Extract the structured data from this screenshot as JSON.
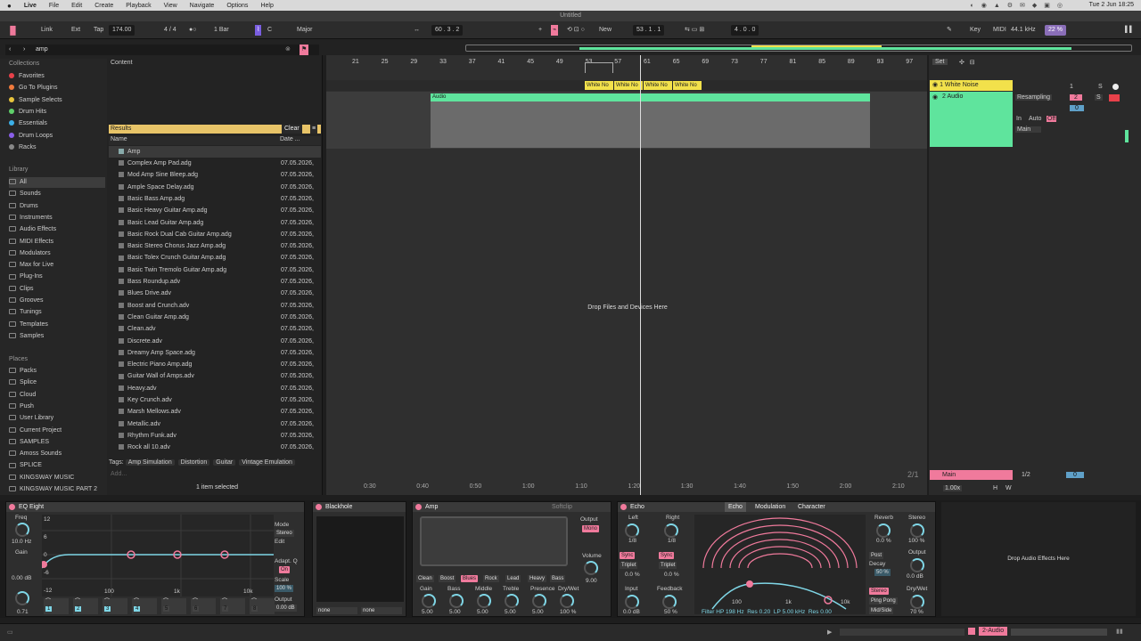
{
  "menubar": {
    "apple": "",
    "app": "Live",
    "items": [
      "File",
      "Edit",
      "Create",
      "Playback",
      "View",
      "Navigate",
      "Options",
      "Help"
    ],
    "clock": "Tue 2 Jun 18:25"
  },
  "window": {
    "title": "Untitled"
  },
  "control": {
    "link": "Link",
    "ext": "Ext",
    "tap": "Tap",
    "tempo": "174.00",
    "sig": "4 / 4",
    "metro": "1 Bar",
    "key": "C",
    "scale": "Major",
    "pos1": "60 .  3 .  2",
    "new": "New",
    "pos2": "53 .  1 .  1",
    "len": "4 .  0 .  0",
    "keymap": "Key",
    "midi": "MIDI",
    "rate": "44.1 kHz",
    "cpu": "22 %"
  },
  "browser": {
    "search": "amp",
    "collections_title": "Collections",
    "collections": [
      {
        "label": "Favorites",
        "color": "#e8414a"
      },
      {
        "label": "Go To Plugins",
        "color": "#f07a3c"
      },
      {
        "label": "Sample Selects",
        "color": "#e8c43c"
      },
      {
        "label": "Drum Hits",
        "color": "#5fd06a"
      },
      {
        "label": "Essentials",
        "color": "#3cb0e8"
      },
      {
        "label": "Drum Loops",
        "color": "#8a5fe8"
      },
      {
        "label": "Racks",
        "color": "#888888"
      }
    ],
    "library_title": "Library",
    "library": [
      "All",
      "Sounds",
      "Drums",
      "Instruments",
      "Audio Effects",
      "MIDI Effects",
      "Modulators",
      "Max for Live",
      "Plug-Ins",
      "Clips",
      "Grooves",
      "Tunings",
      "Templates",
      "Samples"
    ],
    "places_title": "Places",
    "places": [
      "Packs",
      "Splice",
      "Cloud",
      "Push",
      "User Library",
      "Current Project",
      "SAMPLES",
      "Amoss Sounds",
      "SPLICE",
      "KINGSWAY MUSIC",
      "KINGSWAY MUSIC PART 2"
    ],
    "content": "Content",
    "results": "Results",
    "clear": "Clear",
    "col_name": "Name",
    "col_date": "Date ...",
    "folder_row": "Amp",
    "files": [
      {
        "name": "Complex Amp Pad.adg",
        "date": "07.05.2026,"
      },
      {
        "name": "Mod Amp Sine Bleep.adg",
        "date": "07.05.2026,"
      },
      {
        "name": "Ample Space Delay.adg",
        "date": "07.05.2026,"
      },
      {
        "name": "Basic Bass Amp.adg",
        "date": "07.05.2026,"
      },
      {
        "name": "Basic Heavy Guitar Amp.adg",
        "date": "07.05.2026,"
      },
      {
        "name": "Basic Lead Guitar Amp.adg",
        "date": "07.05.2026,"
      },
      {
        "name": "Basic Rock Dual Cab Guitar Amp.adg",
        "date": "07.05.2026,"
      },
      {
        "name": "Basic Stereo Chorus Jazz Amp.adg",
        "date": "07.05.2026,"
      },
      {
        "name": "Basic Tolex Crunch Guitar Amp.adg",
        "date": "07.05.2026,"
      },
      {
        "name": "Basic Twin Tremolo Guitar Amp.adg",
        "date": "07.05.2026,"
      },
      {
        "name": "Bass Roundup.adv",
        "date": "07.05.2026,"
      },
      {
        "name": "Blues Drive.adv",
        "date": "07.05.2026,"
      },
      {
        "name": "Boost and Crunch.adv",
        "date": "07.05.2026,"
      },
      {
        "name": "Clean Guitar Amp.adg",
        "date": "07.05.2026,"
      },
      {
        "name": "Clean.adv",
        "date": "07.05.2026,"
      },
      {
        "name": "Discrete.adv",
        "date": "07.05.2026,"
      },
      {
        "name": "Dreamy Amp Space.adg",
        "date": "07.05.2026,"
      },
      {
        "name": "Electric Piano Amp.adg",
        "date": "07.05.2026,"
      },
      {
        "name": "Guitar Wall of Amps.adv",
        "date": "07.05.2026,"
      },
      {
        "name": "Heavy.adv",
        "date": "07.05.2026,"
      },
      {
        "name": "Key Crunch.adv",
        "date": "07.05.2026,"
      },
      {
        "name": "Marsh Mellows.adv",
        "date": "07.05.2026,"
      },
      {
        "name": "Metallic.adv",
        "date": "07.05.2026,"
      },
      {
        "name": "Rhythm Funk.adv",
        "date": "07.05.2026,"
      },
      {
        "name": "Rock all 10.adv",
        "date": "07.05.2026,"
      }
    ],
    "tags_label": "Tags:",
    "tags": [
      "Amp Simulation",
      "Distortion",
      "Guitar",
      "Vintage Emulation"
    ],
    "add": "Add...",
    "status": "1 item selected"
  },
  "arrangement": {
    "bars": [
      "21",
      "25",
      "29",
      "33",
      "37",
      "41",
      "45",
      "49",
      "53",
      "57",
      "61",
      "65",
      "69",
      "73",
      "77",
      "81",
      "85",
      "89",
      "93",
      "97"
    ],
    "locators": [
      "White No",
      "White No",
      "White No",
      "White No"
    ],
    "clip_name": "Audio",
    "drop": "Drop Files and Devices Here",
    "times": [
      "0:30",
      "0:40",
      "0:50",
      "1:00",
      "1:10",
      "1:20",
      "1:30",
      "1:40",
      "1:50",
      "2:00",
      "2:10"
    ],
    "zoom": "2/1"
  },
  "mixer": {
    "set": "Set",
    "track1": "1 White Noise",
    "track2": "2 Audio",
    "resampling": "Resampling",
    "in": "In",
    "auto": "Auto",
    "off": "Off",
    "main_route": "Main",
    "main": "Main",
    "main_val": "1/2",
    "num1": "1",
    "num2": "2",
    "s": "S",
    "vol": "0",
    "speed": "1.00x",
    "h": "H",
    "w": "W"
  },
  "devices": {
    "eq": {
      "title": "EQ Eight",
      "freq": "Freq",
      "freq_val": "10.0 Hz",
      "gain": "Gain",
      "gain_val": "0.00 dB",
      "q_val": "0.71",
      "mode": "Mode",
      "stereo": "Stereo",
      "edit": "Edit",
      "adapt": "Adapt. Q",
      "on": "On",
      "scale": "Scale",
      "scale_val": "100 %",
      "output": "Output",
      "output_val": "0.00 dB",
      "db": [
        "12",
        "6",
        "0",
        "-6",
        "-12"
      ],
      "freqs": [
        "100",
        "1k",
        "10k"
      ],
      "bands": [
        "1",
        "2",
        "3",
        "4",
        "5",
        "6",
        "7",
        "8"
      ]
    },
    "blackhole": {
      "title": "Blackhole",
      "none1": "none",
      "none2": "none"
    },
    "amp": {
      "title": "Amp",
      "softclip": "Softclip",
      "output": "Output",
      "mono": "Mono",
      "volume": "Volume",
      "volume_val": "9.00",
      "types": [
        "Clean",
        "Boost",
        "Blues",
        "Rock",
        "Lead",
        "Heavy",
        "Bass"
      ],
      "knobs": [
        {
          "label": "Gain",
          "val": "5.00"
        },
        {
          "label": "Bass",
          "val": "5.00"
        },
        {
          "label": "Middle",
          "val": "5.00"
        },
        {
          "label": "Treble",
          "val": "5.00"
        },
        {
          "label": "Presence",
          "val": "5.00"
        },
        {
          "label": "Dry/Wet",
          "val": "100 %"
        }
      ]
    },
    "echo": {
      "title": "Echo",
      "tabs": [
        "Echo",
        "Modulation",
        "Character"
      ],
      "left": "Left",
      "right": "Right",
      "left_val": "1/8",
      "right_val": "1/8",
      "sync": "Sync",
      "triplet": "Triplet",
      "off_l": "0.0 %",
      "off_r": "0.0 %",
      "input": "Input",
      "input_val": "0.0 dB",
      "feedback": "Feedback",
      "feedback_val": "50 %",
      "reverb": "Reverb",
      "reverb_val": "0.0 %",
      "stereo": "Stereo",
      "stereo_val": "100 %",
      "post": "Post",
      "decay": "Decay",
      "decay_val": "50 %",
      "output": "Output",
      "output_val": "0.0 dB",
      "stereo_btn": "Stereo",
      "pingpong": "Ping Pong",
      "midside": "Mid/Side",
      "drywet": "Dry/Wet",
      "drywet_val": "70 %",
      "filter": "Filter",
      "hp": "HP",
      "hp_val": "198 Hz",
      "res": "Res",
      "res_val": "0.20",
      "lp": "LP",
      "lp_val": "5.00 kHz",
      "res2_val": "0.00",
      "f100": "100",
      "f1k": "1k",
      "f10k": "10k"
    },
    "drop": "Drop Audio Effects Here"
  },
  "bottom": {
    "track": "2-Audio"
  },
  "colors": {
    "accent_green": "#5fe49d",
    "yellow": "#f2e14b",
    "pink": "#f07a9c",
    "results": "#e8c468"
  }
}
